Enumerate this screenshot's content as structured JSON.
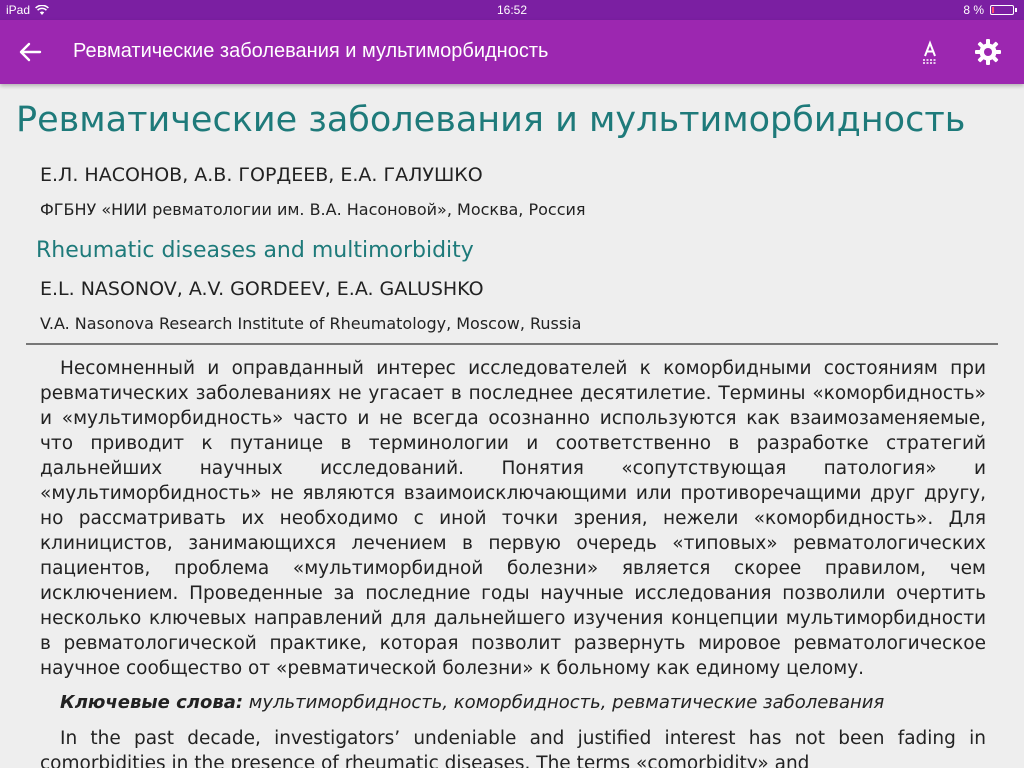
{
  "status_bar": {
    "device": "iPad",
    "time": "16:52",
    "battery": "8 %",
    "battery_level": 0.08
  },
  "app_bar": {
    "title": "Ревматические заболевания и мультиморбидность",
    "icons": {
      "back": "arrow-left-icon",
      "font": "font-size-icon",
      "settings": "gear-icon"
    }
  },
  "article": {
    "title_ru": "Ревматические заболевания и мультиморбидность",
    "authors_ru": "Е.Л. НАСОНОВ, А.В. ГОРДЕЕВ, Е.А. ГАЛУШКО",
    "affiliation_ru": "ФГБНУ «НИИ ревматологии им. В.А. Насоновой», Москва, Россия",
    "title_en": "Rheumatic diseases and multimorbidity",
    "authors_en": "E.L. NASONOV, A.V. GORDEEV, E.A. GALUSHKO",
    "affiliation_en": "V.A. Nasonova Research Institute of Rheumatology, Moscow, Russia",
    "abstract_ru": "Несомненный и оправданный интерес исследователей к коморбидными состояниям при ревматических заболеваниях не угасает в последнее десятилетие. Термины «коморбидность» и «мультиморбидность» часто и не всегда осознанно используются как взаимозаменяемые, что приводит к путанице в терминологии и соответственно в разработке стратегий дальнейших научных исследований. Понятия «сопутствующая патология» и «мультиморбидность» не являются взаимоисключающими или противоречащими друг другу, но рассматривать их необходимо с иной точки зрения, нежели «коморбидность». Для клиницистов, занимающихся лечением в первую очередь «типовых» ревматологических пациентов, проблема «мультиморбидной болезни» является скорее правилом, чем исключением. Проведенные за последние годы научные исследования позволили очертить несколько ключевых направлений для дальнейшего изучения концепции мультиморбидности в ревматологической практике, которая позволит развернуть мировое ревматологическое научное сообщество от «ревматической болезни» к больному как единому целому.",
    "keywords_label": "Ключевые слова:",
    "keywords_value": "мультиморбидность, коморбидность, ревматические заболевания",
    "abstract_en": "In the past decade, investigators’ undeniable and justified interest has not been fading in comorbidities in the presence of rheumatic diseases. The terms «comorbidity» and"
  }
}
